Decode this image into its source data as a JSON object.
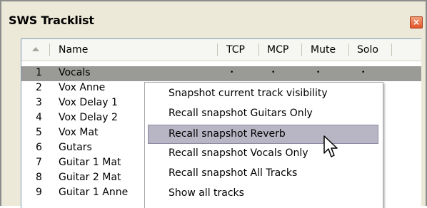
{
  "window": {
    "title": "SWS Tracklist",
    "close_symbol": "×"
  },
  "columns": [
    "Name",
    "TCP",
    "MCP",
    "Mute",
    "Solo"
  ],
  "rows": [
    {
      "num": "1",
      "name": "Vocals"
    },
    {
      "num": "2",
      "name": "Vox Anne"
    },
    {
      "num": "3",
      "name": "Vox Delay 1"
    },
    {
      "num": "4",
      "name": "Vox Delay 2"
    },
    {
      "num": "5",
      "name": "Vox Mat"
    },
    {
      "num": "6",
      "name": "Gutars"
    },
    {
      "num": "7",
      "name": "Guitar 1 Mat"
    },
    {
      "num": "8",
      "name": "Guitar 2 Mat"
    },
    {
      "num": "9",
      "name": "Guitar 1 Anne"
    }
  ],
  "selected_row": {
    "tcp": "•",
    "mcp": "•",
    "mute": "•",
    "solo": "•"
  },
  "context_menu": {
    "items": [
      "Snapshot current track visibility",
      "Recall snapshot Guitars Only",
      "Recall snapshot Reverb",
      "Recall snapshot Vocals Only",
      "Recall snapshot All Tracks",
      "Show all tracks"
    ],
    "highlighted_index": 2
  },
  "colors": {
    "selection": "#9a9a96",
    "menu_highlight": "#b8b6c4",
    "close_button": "#e2552a"
  }
}
